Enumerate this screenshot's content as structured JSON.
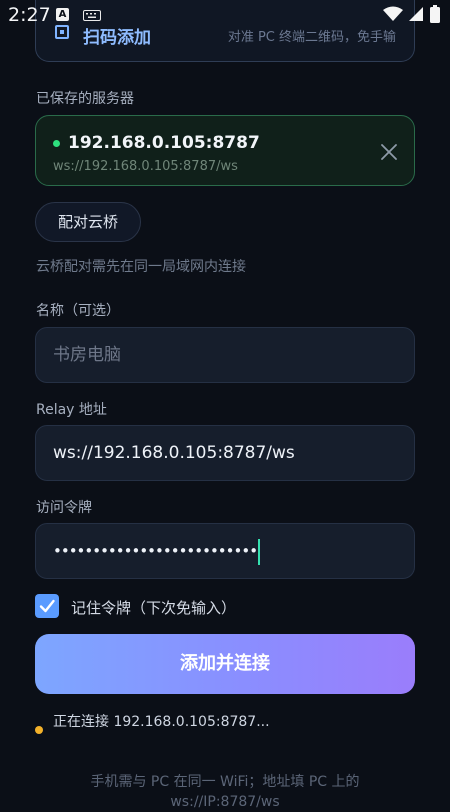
{
  "status_bar": {
    "time": "2:27",
    "icons": [
      "a-icon",
      "keyboard-icon",
      "wifi-icon",
      "signal-icon",
      "battery-icon"
    ]
  },
  "scan": {
    "title": "扫码添加",
    "hint": "对准 PC 终端二维码，免手输"
  },
  "saved_servers": {
    "label": "已保存的服务器",
    "items": [
      {
        "name": "192.168.0.105:8787",
        "url": "ws://192.168.0.105:8787/ws",
        "status_color": "#2ee07e"
      }
    ]
  },
  "cloud_bridge": {
    "button_label": "配对云桥",
    "helper": "云桥配对需先在同一局域网内连接"
  },
  "form": {
    "name_label": "名称（可选）",
    "name_placeholder": "书房电脑",
    "relay_label": "Relay 地址",
    "relay_value": "ws://192.168.0.105:8787/ws",
    "token_label": "访问令牌",
    "token_value": "••••••••••••••••••••••••••",
    "remember_label": "记住令牌（下次免输入）",
    "remember_checked": true
  },
  "primary": {
    "label": "添加并连接"
  },
  "connection": {
    "text": "正在连接 192.168.0.105:8787...",
    "dot_color": "#f3b12a"
  },
  "footer": {
    "line1": "手机需与 PC 在同一 WiFi；地址填 PC 上的",
    "line2": "ws://IP:8787/ws"
  },
  "colors": {
    "accent": "#7da6ff",
    "background": "#0b0f17",
    "success": "#2ee07e",
    "warning": "#f3b12a"
  }
}
